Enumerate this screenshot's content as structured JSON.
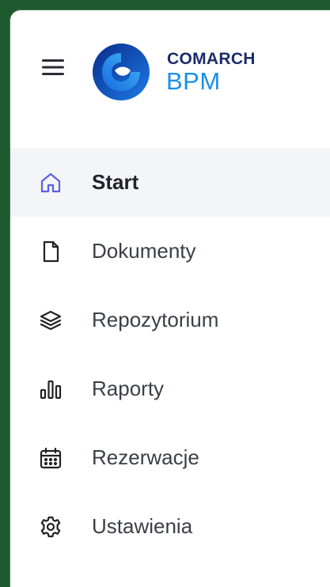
{
  "header": {
    "menu_icon": "hamburger-menu-icon",
    "logo": {
      "line1": "COMARCH",
      "line2": "BPM"
    }
  },
  "colors": {
    "logo_dark": "#1c2d6b",
    "logo_blue": "#1a8fe6",
    "active_icon": "#5b5fe8",
    "active_bg": "#f4f5f8",
    "frame": "#1e5a30"
  },
  "nav": {
    "items": [
      {
        "label": "Start",
        "icon": "home-icon",
        "active": true
      },
      {
        "label": "Dokumenty",
        "icon": "document-icon",
        "active": false
      },
      {
        "label": "Repozytorium",
        "icon": "layers-icon",
        "active": false
      },
      {
        "label": "Raporty",
        "icon": "bar-chart-icon",
        "active": false
      },
      {
        "label": "Rezerwacje",
        "icon": "calendar-icon",
        "active": false
      },
      {
        "label": "Ustawienia",
        "icon": "gear-icon",
        "active": false
      }
    ]
  }
}
